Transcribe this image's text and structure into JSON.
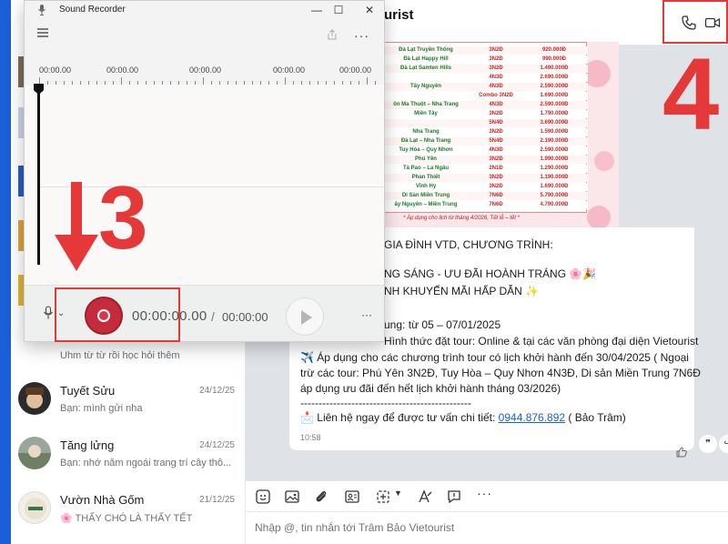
{
  "recorder": {
    "title": "Sound Recorder",
    "window_controls": [
      "—",
      "☐",
      "✕"
    ],
    "ruler_labels": [
      "00:00.00",
      "00:00.00",
      "00:00.00",
      "00:00.00",
      "00:00.00"
    ],
    "current_time": "00:00:00.00",
    "separator": "/",
    "total_time": "00:00:00",
    "more": "···"
  },
  "chat": {
    "title_partial": "urist",
    "conversations": [
      {
        "name": "",
        "preview": "Uhm từ từ rồi học hỏi thêm",
        "date": ""
      },
      {
        "name": "Tuyết Sửu",
        "preview": "Bạn: mình gửi nha",
        "date": "24/12/25"
      },
      {
        "name": "Tăng lửng",
        "preview": "Bạn: nhớ năm ngoái trang trí cây thô...",
        "date": "24/12/25"
      },
      {
        "name": "Vườn Nhà Gốm",
        "preview": "🌸 THẤY CHÓ LÀ THẤY TẾT",
        "date": "21/12/25"
      }
    ],
    "banner_rows": [
      {
        "dest": "Đà Lạt Truyền Thống",
        "dur": "3N2Đ",
        "price": "920.000Đ"
      },
      {
        "dest": "Đà Lạt Happy Hill",
        "dur": "3N2Đ",
        "price": "990.000Đ"
      },
      {
        "dest": "Đà Lạt Samten Hills",
        "dur": "3N2Đ",
        "price": "1.490.000Đ"
      },
      {
        "dest": "",
        "dur": "4N3Đ",
        "price": "2.690.000Đ"
      },
      {
        "dest": "Tây Nguyên",
        "dur": "4N3Đ",
        "price": "2.590.000Đ"
      },
      {
        "dest": "",
        "dur": "Combo 3N2Đ",
        "price": "1.690.000Đ"
      },
      {
        "dest": "ôn Ma Thuột – Nha Trang",
        "dur": "4N3Đ",
        "price": "2.590.000Đ"
      },
      {
        "dest": "Miền Tây",
        "dur": "3N2Đ",
        "price": "1.790.000Đ"
      },
      {
        "dest": "",
        "dur": "5N4Đ",
        "price": "3.690.000Đ"
      },
      {
        "dest": "Nha Trang",
        "dur": "3N2Đ",
        "price": "1.590.000Đ"
      },
      {
        "dest": "Đà Lạt – Nha Trang",
        "dur": "5N4Đ",
        "price": "2.190.000Đ"
      },
      {
        "dest": "Tuy Hòa – Quy Nhơn",
        "dur": "4N3Đ",
        "price": "2.590.000Đ"
      },
      {
        "dest": "Phú Yên",
        "dur": "3N2Đ",
        "price": "1.990.000Đ"
      },
      {
        "dest": "Tà Pao – La Ngâu",
        "dur": "2N1Đ",
        "price": "1.290.000Đ"
      },
      {
        "dest": "Phan Thiết",
        "dur": "3N2Đ",
        "price": "1.190.000Đ"
      },
      {
        "dest": "Vĩnh Hy",
        "dur": "3N2Đ",
        "price": "1.690.000Đ"
      },
      {
        "dest": "Di Sản Miền Trung",
        "dur": "7N6Đ",
        "price": "5.790.000Đ"
      },
      {
        "dest": "ây Nguyên – Miền Trung",
        "dur": "7N6Đ",
        "price": "4.790.000Đ"
      }
    ],
    "banner_footer": "* Áp dụng cho lịch từ tháng 4/2026, Tết lễ – tết *",
    "message_lines": [
      "GIA ĐÌNH VTD, CHƯƠNG TRÌNH:",
      "NG SÁNG - ƯU ĐÃI HOÀNH TRÁNG 🌸🎉",
      "NH KHUYẾN MÃI HẤP DẪN ✨",
      "ung: từ 05 – 07/01/2025",
      "Hình thức đặt tour: Online & tại các văn phòng đại diện Vietourist",
      "✈️ Áp dụng cho các chương trình tour có lịch khởi hành đến 30/04/2025 ( Ngoại",
      "trừ các tour: Phú Yên 3N2Đ, Tuy Hòa – Quy Nhơn 4N3Đ, Di sản Miền Trung 7N6Đ",
      "áp dụng ưu đãi đến hết lịch khởi hành tháng 03/2026)",
      "-----------------------------------------------"
    ],
    "contact_prefix": "📩 Liên hệ ngay để được tư vấn chi tiết: ",
    "contact_phone": "0944.876.892",
    "contact_suffix": " ( Bảo Trâm)",
    "message_time": "10:58",
    "composer_placeholder": "Nhập @, tin nhắn tới Trâm Bảo Vietourist"
  },
  "annotations": {
    "step3": "3",
    "step4": "4",
    "accent": "#e53838"
  }
}
